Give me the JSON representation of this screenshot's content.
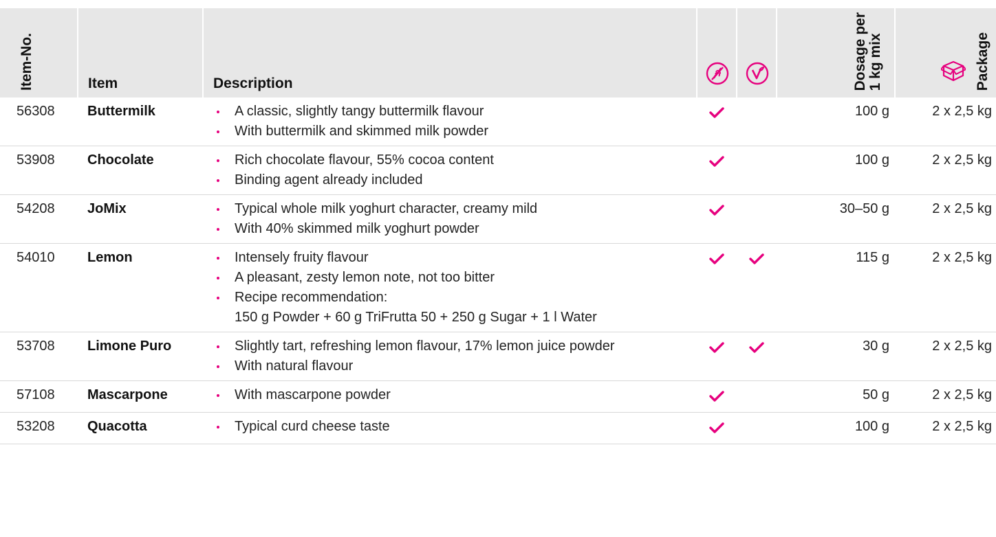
{
  "header": {
    "item_no": "Item-No.",
    "item": "Item",
    "description": "Description",
    "gluten_free_icon": "gluten-free-icon",
    "vegan_icon": "vegan-icon",
    "dosage_line1": "Dosage per",
    "dosage_line2": "1 kg mix",
    "package": "Package",
    "package_icon": "package-box-icon"
  },
  "accent_color": "#e6007e",
  "header_bg": "#e7e7e7",
  "rows": [
    {
      "no": "56308",
      "item": "Buttermilk",
      "desc": [
        "A classic, slightly tangy buttermilk flavour",
        "With buttermilk and skimmed milk powder"
      ],
      "gluten_free": true,
      "vegan": false,
      "dosage": "100 g",
      "package": "2 x 2,5 kg"
    },
    {
      "no": "53908",
      "item": "Chocolate",
      "desc": [
        "Rich chocolate flavour, 55% cocoa content",
        "Binding agent already included"
      ],
      "gluten_free": true,
      "vegan": false,
      "dosage": "100 g",
      "package": "2 x 2,5 kg"
    },
    {
      "no": "54208",
      "item": "JoMix",
      "desc": [
        "Typical whole milk yoghurt character, creamy mild",
        "With 40% skimmed milk yoghurt powder"
      ],
      "gluten_free": true,
      "vegan": false,
      "dosage": "30–50 g",
      "package": "2 x 2,5 kg"
    },
    {
      "no": "54010",
      "item": "Lemon",
      "desc": [
        "Intensely fruity flavour",
        "A pleasant, zesty lemon note, not too bitter",
        "Recipe recommendation:\n150 g Powder + 60 g TriFrutta 50 + 250 g Sugar + 1 l Water"
      ],
      "gluten_free": true,
      "vegan": true,
      "dosage": "115 g",
      "package": "2 x 2,5 kg"
    },
    {
      "no": "53708",
      "item": "Limone Puro",
      "desc": [
        "Slightly tart, refreshing lemon flavour, 17% lemon juice powder",
        "With natural flavour"
      ],
      "gluten_free": true,
      "vegan": true,
      "dosage": "30 g",
      "package": "2 x 2,5 kg"
    },
    {
      "no": "57108",
      "item": "Mascarpone",
      "desc": [
        "With mascarpone powder"
      ],
      "gluten_free": true,
      "vegan": false,
      "dosage": "50 g",
      "package": "2 x 2,5 kg"
    },
    {
      "no": "53208",
      "item": "Quacotta",
      "desc": [
        "Typical curd cheese taste"
      ],
      "gluten_free": true,
      "vegan": false,
      "dosage": "100 g",
      "package": "2 x 2,5 kg"
    }
  ]
}
